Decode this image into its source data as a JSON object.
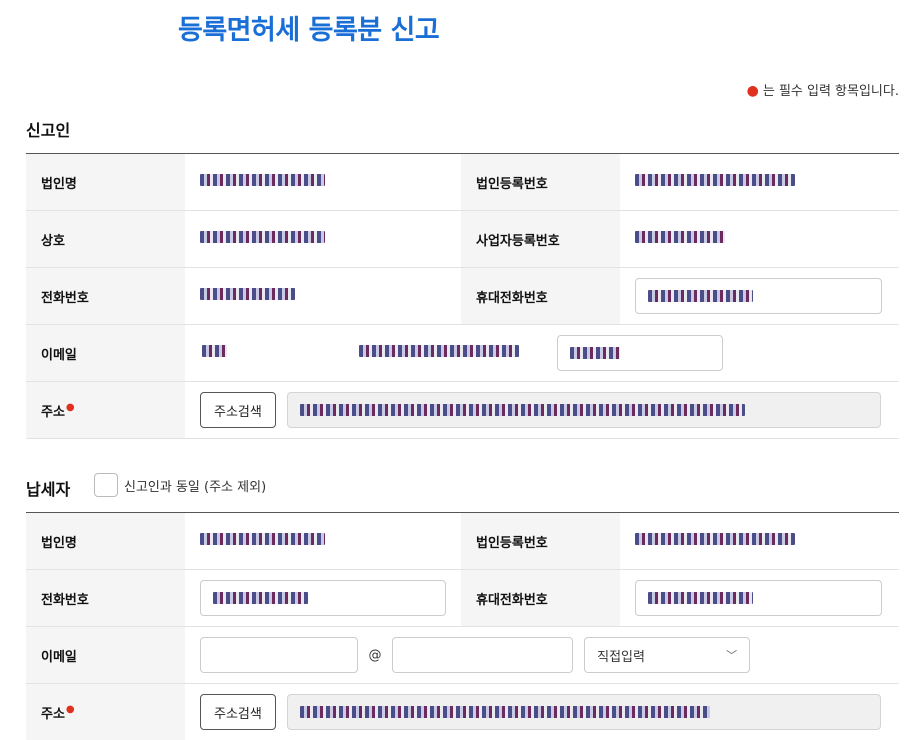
{
  "title": "등록면허세 등록분 신고",
  "required_note": "는 필수 입력 항목입니다.",
  "filer": {
    "section_title": "신고인",
    "corp_name_label": "법인명",
    "corp_reg_no_label": "법인등록번호",
    "trade_name_label": "상호",
    "biz_reg_no_label": "사업자등록번호",
    "phone_label": "전화번호",
    "mobile_label": "휴대전화번호",
    "email_label": "이메일",
    "address_label": "주소",
    "address_search_button": "주소검색"
  },
  "taxpayer": {
    "section_title": "납세자",
    "same_as_filer_label": "신고인과 동일 (주소 제외)",
    "corp_name_label": "법인명",
    "corp_reg_no_label": "법인등록번호",
    "phone_label": "전화번호",
    "mobile_label": "휴대전화번호",
    "email_label": "이메일",
    "email_at": "@",
    "email_domain_select": "직접입력",
    "address_label": "주소",
    "address_search_button": "주소검색"
  },
  "icons": {
    "required_marker": "red-dot",
    "select_arrow": "chevron-down-icon"
  },
  "colors": {
    "title": "#1a6fd6",
    "required": "#e0301e"
  }
}
